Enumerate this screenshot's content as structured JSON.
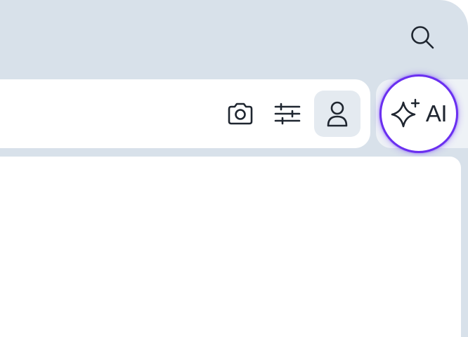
{
  "header": {
    "search_icon": "search-icon"
  },
  "toolbar": {
    "camera_icon": "camera-icon",
    "filters_icon": "sliders-icon",
    "profile_icon": "user-icon"
  },
  "ai": {
    "label": "AI",
    "icon": "sparkle-icon",
    "highlight_color": "#6a2ff0"
  },
  "colors": {
    "background": "#d8e1ea",
    "surface": "#ffffff",
    "selected_tool_bg": "#e4eaf0",
    "icon": "#1f2630"
  }
}
